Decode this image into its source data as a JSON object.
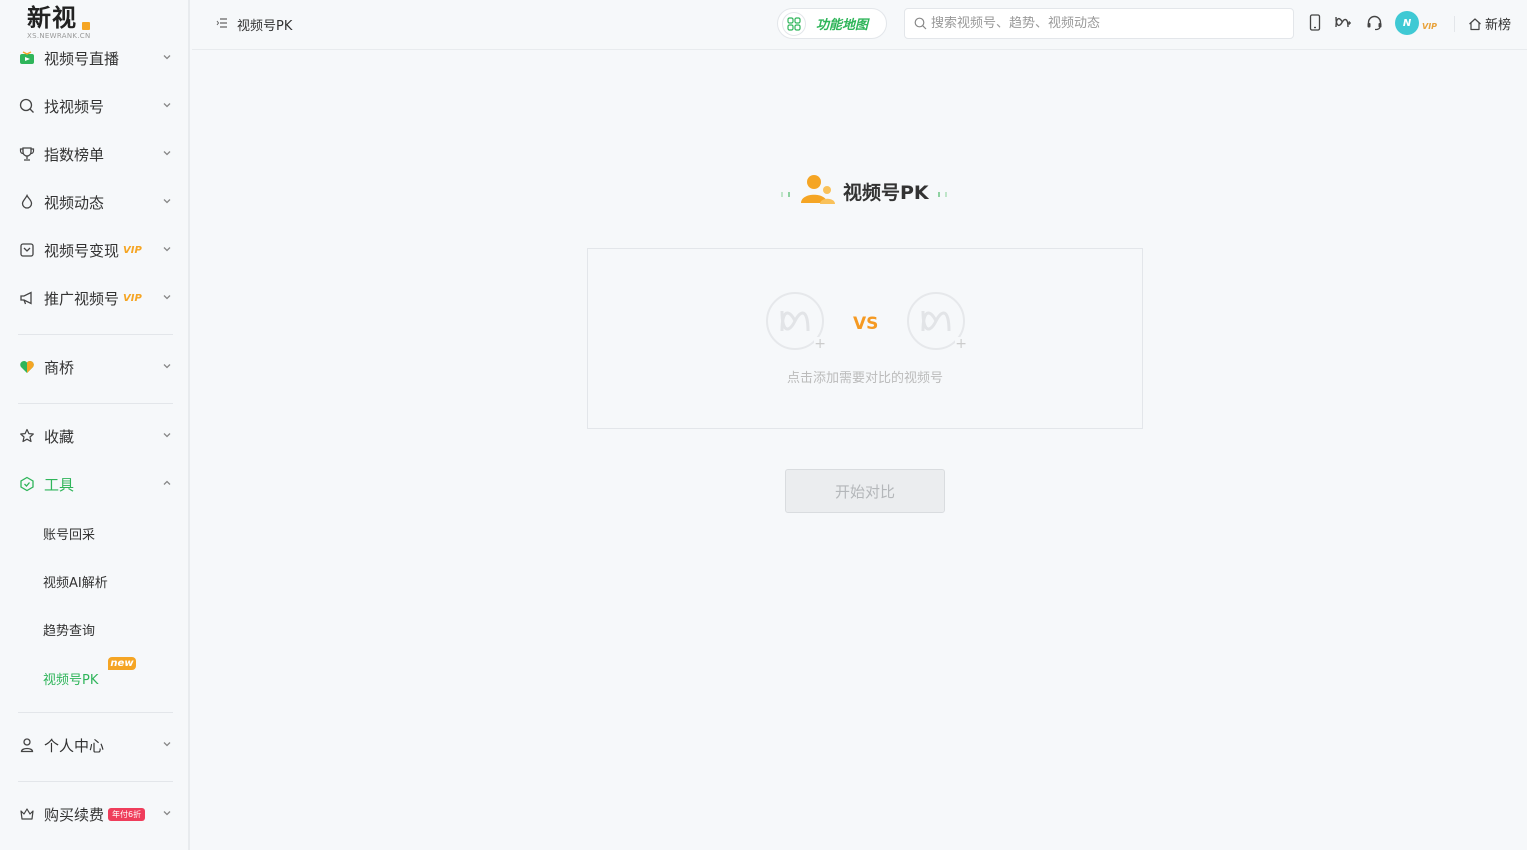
{
  "logo": {
    "main": "新视",
    "sub": "XS.NEWRANK.CN"
  },
  "sidebar": {
    "items": [
      {
        "label": "视频号直播"
      },
      {
        "label": "找视频号"
      },
      {
        "label": "指数榜单"
      },
      {
        "label": "视频动态"
      },
      {
        "label": "视频号变现",
        "badge": "VIP"
      },
      {
        "label": "推广视频号",
        "badge": "VIP"
      },
      {
        "label": "商桥"
      },
      {
        "label": "收藏"
      },
      {
        "label": "工具"
      },
      {
        "label": "个人中心"
      },
      {
        "label": "购买续费",
        "badge": "年付6折"
      }
    ],
    "tools_sub": [
      {
        "label": "账号回采"
      },
      {
        "label": "视频AI解析"
      },
      {
        "label": "趋势查询"
      },
      {
        "label": "视频号PK",
        "badge": "new"
      }
    ]
  },
  "header": {
    "breadcrumb": "视频号PK",
    "func_map_label": "功能地图",
    "search_placeholder": "搜索视频号、趋势、视频动态",
    "avatar_text": "N",
    "vip_text": "VIP",
    "home_label": "新榜"
  },
  "main": {
    "title": "视频号PK",
    "vs_label": "VS",
    "hint": "点击添加需要对比的视频号",
    "start_button": "开始对比"
  },
  "colors": {
    "accent": "#2fb55a",
    "vip": "#f5a524",
    "vs": "#f59a23"
  }
}
